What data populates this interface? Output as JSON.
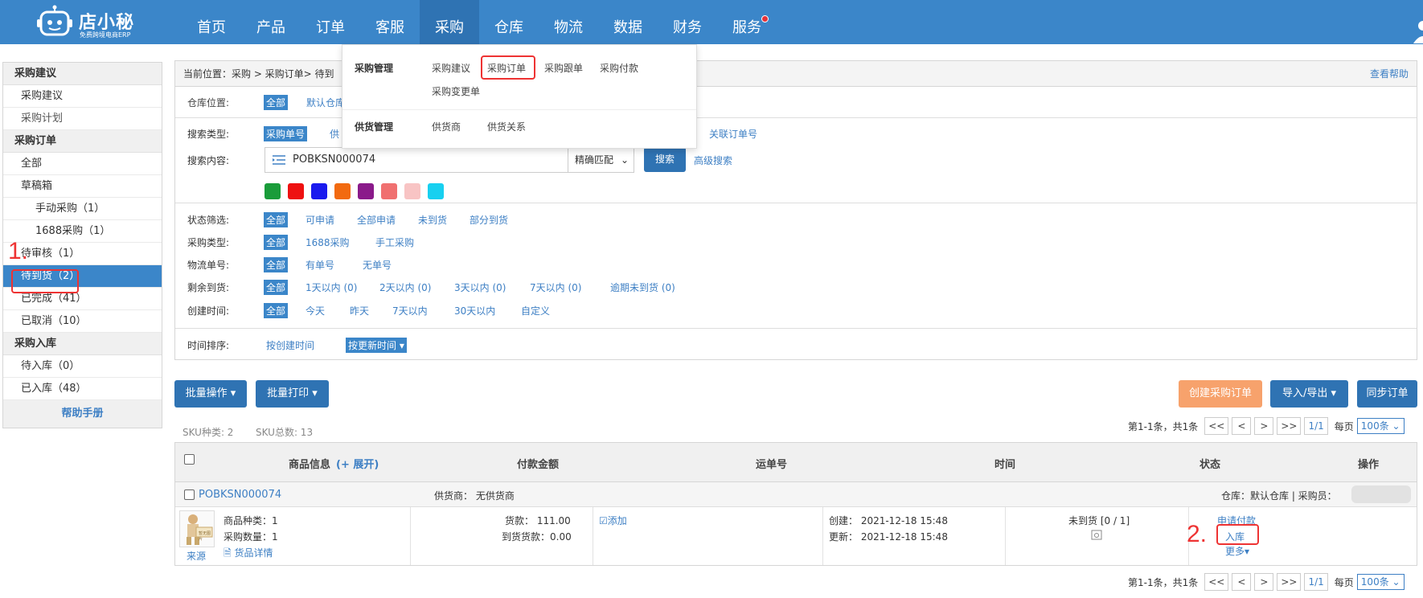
{
  "topnav": {
    "logo_name": "店小秘",
    "logo_sub": "免费跨境电商ERP",
    "items": [
      "首页",
      "产品",
      "订单",
      "客服",
      "采购",
      "仓库",
      "物流",
      "数据",
      "财务",
      "服务"
    ]
  },
  "dropdown": {
    "group1": "采购管理",
    "group1_items": [
      "采购建议",
      "采购订单",
      "采购跟单",
      "采购付款",
      "采购变更单"
    ],
    "group2": "供货管理",
    "group2_items": [
      "供货商",
      "供货关系"
    ]
  },
  "sidebar": {
    "sec1": "采购建议",
    "sec1_items": [
      "采购建议",
      "采购计划"
    ],
    "sec2": "采购订单",
    "sec2_items": [
      "全部",
      "草稿箱",
      "手动采购（1）",
      "1688采购（1）",
      "待审核（1）",
      "待到货（2）",
      "已完成（41）",
      "已取消（10）"
    ],
    "sec3": "采购入库",
    "sec3_items": [
      "待入库（0）",
      "已入库（48）"
    ],
    "help": "帮助手册"
  },
  "annotations": {
    "a1": "1.",
    "a2": "2."
  },
  "breadcrumb": "当前位置：采购 > 采购订单> 待到",
  "help_link": "查看帮助",
  "filters": {
    "warehouse_label": "仓库位置:",
    "warehouse_opts": [
      "全部",
      "默认仓库"
    ],
    "search_type_label": "搜索类型:",
    "search_type_opts": [
      "采购单号",
      "供",
      "关联订单号"
    ],
    "search_content_label": "搜索内容:",
    "search_value": "POBKSN000074",
    "match_mode": "精确匹配",
    "search_btn": "搜索",
    "advanced": "高级搜索",
    "colors": [
      "#1a9c3a",
      "#ee1111",
      "#1a1aee",
      "#f26a10",
      "#8a1a8a",
      "#f07070",
      "#f8c4c4",
      "#18d0f0"
    ],
    "status_label": "状态筛选:",
    "status_opts": [
      "全部",
      "可申请",
      "全部申请",
      "未到货",
      "部分到货"
    ],
    "ptype_label": "采购类型:",
    "ptype_opts": [
      "全部",
      "1688采购",
      "手工采购"
    ],
    "logistics_label": "物流单号:",
    "logistics_opts": [
      "全部",
      "有单号",
      "无单号"
    ],
    "remain_label": "剩余到货:",
    "remain_opts": [
      "全部",
      "1天以内 (0)",
      "2天以内 (0)",
      "3天以内 (0)",
      "7天以内 (0)",
      "逾期未到货 (0)"
    ],
    "ctime_label": "创建时间:",
    "ctime_opts": [
      "全部",
      "今天",
      "昨天",
      "7天以内",
      "30天以内",
      "自定义"
    ],
    "sort_label": "时间排序:",
    "sort_opts": [
      "按创建时间",
      "按更新时间"
    ]
  },
  "toolbar": {
    "batch_ops": "批量操作",
    "batch_print": "批量打印",
    "create": "创建采购订单",
    "import_export": "导入/导出",
    "sync": "同步订单"
  },
  "summary": {
    "sku_types": "SKU种类: 2",
    "sku_total": "SKU总数: 13"
  },
  "pager": {
    "text": "第1-1条，共1条",
    "first": "<<",
    "prev": "<",
    "next": ">",
    "last": ">>",
    "page": "1/1",
    "per_label": "每页",
    "per_value": "100条"
  },
  "table": {
    "headers": [
      "商品信息",
      "(+ 展开)",
      "付款金额",
      "运单号",
      "时间",
      "状态",
      "操作"
    ],
    "order_no": "POBKSN000074",
    "supplier": "供货商：  无供货商",
    "warehouse_info": "仓库：默认仓库 | 采购员：",
    "thumb_text": "暂无图片",
    "source": "来源",
    "kinds": "商品种类：1",
    "qty": "采购数量：1",
    "goods_detail": "货品详情",
    "payment": "货款：  111.00",
    "arrival_payment": "到货货款：0.00",
    "add_tracking": "添加",
    "created": "创建：  2021-12-18 15:48",
    "updated": "更新：  2021-12-18 15:48",
    "status": "未到货 [0 / 1]",
    "op_apply": "申请付款",
    "op_inbound": "入库",
    "op_more": "更多"
  }
}
